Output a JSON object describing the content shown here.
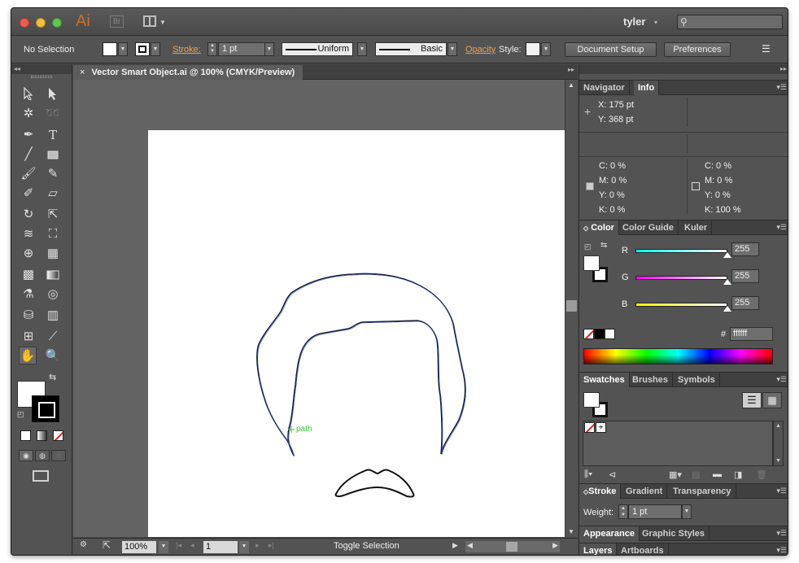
{
  "app": {
    "logo": "Ai",
    "bridge": "Br",
    "user": "tyler"
  },
  "control_bar": {
    "selection": "No Selection",
    "stroke_label": "Stroke:",
    "stroke_weight": "1 pt",
    "profile": "Uniform",
    "brush": "Basic",
    "opacity_label": "Opacity",
    "style_label": "Style:",
    "document_setup": "Document Setup",
    "preferences": "Preferences"
  },
  "document": {
    "tab_title": "Vector Smart Object.ai @ 100% (CMYK/Preview)",
    "hover_label": "path"
  },
  "status_bar": {
    "zoom": "100%",
    "page": "1",
    "toggle": "Toggle Selection"
  },
  "info_panel": {
    "tabs": [
      "Navigator",
      "Info"
    ],
    "x": "X:  175 pt",
    "y": "Y:  368 pt",
    "left_cmyk": [
      "C: 0 %",
      "M: 0 %",
      "Y: 0 %",
      "K: 0 %"
    ],
    "right_cmyk": [
      "C: 0 %",
      "M: 0 %",
      "Y: 0 %",
      "K: 100 %"
    ]
  },
  "color_panel": {
    "tabs": [
      "Color",
      "Color Guide",
      "Kuler"
    ],
    "r_label": "R",
    "g_label": "G",
    "b_label": "B",
    "r_value": "255",
    "g_value": "255",
    "b_value": "255",
    "hex_symbol": "#",
    "hex": "ffffff"
  },
  "swatches_panel": {
    "tabs": [
      "Swatches",
      "Brushes",
      "Symbols"
    ]
  },
  "stroke_panel": {
    "tabs": [
      "Stroke",
      "Gradient",
      "Transparency"
    ],
    "weight_label": "Weight:",
    "weight_value": "1 pt"
  },
  "appearance_panel": {
    "tabs": [
      "Appearance",
      "Graphic Styles"
    ]
  },
  "layers_panel": {
    "tabs": [
      "Layers",
      "Artboards"
    ]
  },
  "colors": {
    "ui_bg": "#535353",
    "canvas": "#636363",
    "accent": "#f0a04b",
    "path_selection": "#3355cc",
    "smart_guide": "#33cc33"
  }
}
